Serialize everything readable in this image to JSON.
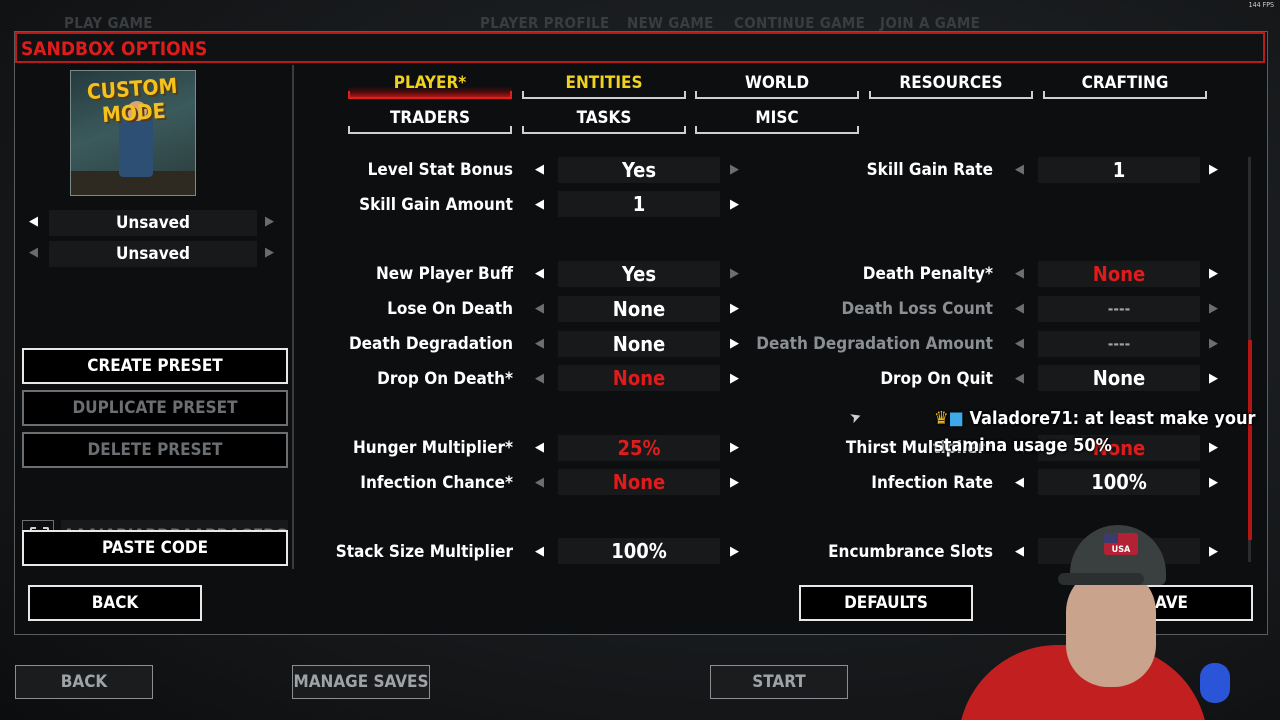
{
  "fps": "144 FPS",
  "top_nav": [
    "PLAY GAME",
    "PLAYER PROFILE",
    "NEW GAME",
    "CONTINUE GAME",
    "JOIN A GAME"
  ],
  "panel": {
    "title": "SANDBOX OPTIONS"
  },
  "sidebar": {
    "logo_text": "CUSTOM MODE",
    "preset_selectors": [
      "Unsaved",
      "Unsaved"
    ],
    "buttons": {
      "create": "CREATE PRESET",
      "duplicate": "DUPLICATE PRESET",
      "delete": "DELETE PRESET",
      "paste": "PASTE CODE"
    },
    "code_value": "AAAJABJARDBAABBAGFBGG..."
  },
  "tabs": [
    {
      "label": "PLAYER*",
      "active": true
    },
    {
      "label": "ENTITIES",
      "active": false
    },
    {
      "label": "WORLD",
      "active": false
    },
    {
      "label": "RESOURCES",
      "active": false
    },
    {
      "label": "CRAFTING",
      "active": false
    },
    {
      "label": "TRADERS",
      "active": false
    },
    {
      "label": "TASKS",
      "active": false
    },
    {
      "label": "MISC",
      "active": false
    }
  ],
  "options_left": [
    {
      "label": "Level Stat Bonus",
      "value": "Yes"
    },
    {
      "label": "Skill Gain Amount",
      "value": "1"
    },
    {
      "label": "New Player Buff",
      "value": "Yes"
    },
    {
      "label": "Lose On Death",
      "value": "None"
    },
    {
      "label": "Death Degradation",
      "value": "None"
    },
    {
      "label": "Drop On Death*",
      "value": "None"
    },
    {
      "label": "Hunger Multiplier*",
      "value": "25%"
    },
    {
      "label": "Infection Chance*",
      "value": "None"
    },
    {
      "label": "Stack Size Multiplier",
      "value": "100%"
    }
  ],
  "options_right": [
    {
      "label": "Skill Gain Rate",
      "value": "1"
    },
    {
      "label": "Death Penalty*",
      "value": "None"
    },
    {
      "label": "Death Loss Count",
      "value": "----"
    },
    {
      "label": "Death Degradation Amount",
      "value": "----"
    },
    {
      "label": "Drop On Quit",
      "value": "None"
    },
    {
      "label": "Thirst Multiplier*",
      "value": "None"
    },
    {
      "label": "Infection Rate",
      "value": "100%"
    },
    {
      "label": "Encumbrance Slots",
      "value": ""
    }
  ],
  "bottom_buttons": {
    "back": "BACK",
    "defaults": "DEFAULTS",
    "save": "SAVE"
  },
  "footer": {
    "back": "BACK",
    "manage_saves": "MANAGE SAVES",
    "start": "START"
  },
  "chat": {
    "user": "Valadore71:",
    "message1": "at least make your",
    "message2": "stamina usage 50%"
  },
  "webcam": {
    "cap_text": "USA"
  },
  "colors": {
    "accent_red": "#e01b1b",
    "tab_gold": "#f1d21f",
    "panel_bg": "#0d0e10"
  }
}
